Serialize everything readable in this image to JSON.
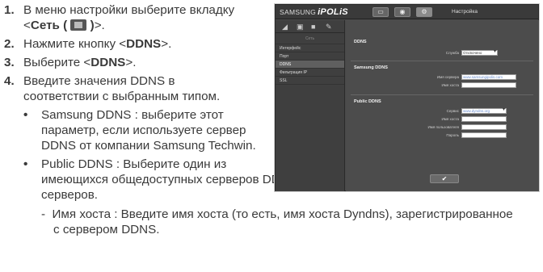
{
  "steps": [
    {
      "num": "1.",
      "line1": "В меню настройки выберите вкладку",
      "line2_pre": "<",
      "line2_bold": "Сеть (",
      "line2_bold_end": ")",
      "line2_post": ">."
    },
    {
      "num": "2.",
      "pre": "Нажмите кнопку <",
      "bold": "DDNS",
      "post": ">."
    },
    {
      "num": "3.",
      "pre": "Выберите <",
      "bold": "DDNS",
      "post": ">."
    },
    {
      "num": "4.",
      "line1": "Введите значения DDNS в",
      "line2": "соответствии с выбранным типом."
    }
  ],
  "bullets": [
    {
      "dot": "•",
      "lines": [
        "Samsung DDNS : выберите этот",
        "параметр, если используете сервер",
        "DDNS от компании Samsung Techwin."
      ]
    },
    {
      "dot": "•",
      "lines": [
        "Public DDNS : Выберите один из",
        "имеющихся общедоступных серверов DDNS, если используется этот тип",
        "серверов."
      ]
    }
  ],
  "dash_item": {
    "dash": "-",
    "lines": [
      "Имя хоста : Введите имя хоста (то есть, имя хоста Dyndns), зарегистрированное",
      "с сервером DDNS."
    ]
  },
  "ui": {
    "logo_small": "SAMSUNG",
    "logo_big": "iPOLiS",
    "top_title": "Настройка",
    "side_header": "Сеть",
    "side_items": [
      "Интерфейс",
      "Порт",
      "DDNS",
      "Фильтрация IP",
      "SSL"
    ],
    "sections": {
      "ddns": "DDNS",
      "samsung": "Samsung DDNS",
      "public": "Public DDNS"
    },
    "labels": {
      "use": "Служба",
      "samsung_server": "Имя сервера",
      "samsung_host": "Имя хоста",
      "public_service": "Сервис",
      "public_host": "Имя хоста",
      "public_user": "Имя пользователя",
      "public_password": "Пароль"
    },
    "values": {
      "use": "Отключено",
      "samsung_server": "www.samsungipolis.com",
      "public_service": "www.dyndns.org"
    },
    "apply": "✔"
  }
}
